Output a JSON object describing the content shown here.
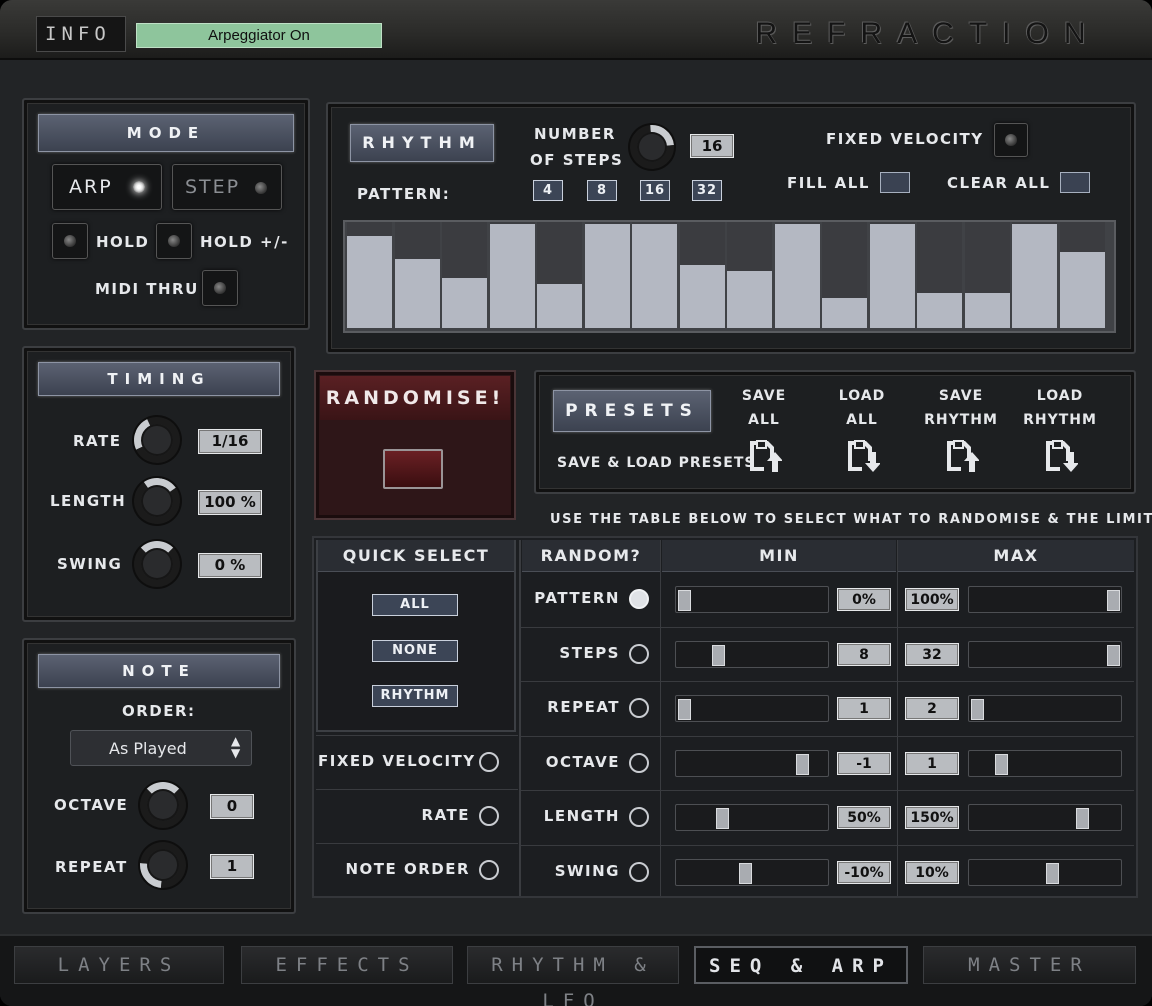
{
  "header": {
    "info_tag": "INFO",
    "info_display": "Arpeggiator On",
    "logo": "REFRACTION"
  },
  "mode": {
    "title": "MODE",
    "arp": "ARP",
    "step": "STEP",
    "hold": "HOLD",
    "hold_pm": "HOLD +/-",
    "midi_thru": "MIDI THRU",
    "arp_on": true
  },
  "timing": {
    "title": "TIMING",
    "rate_label": "RATE",
    "rate_value": "1/16",
    "length_label": "LENGTH",
    "length_value": "100 %",
    "swing_label": "SWING",
    "swing_value": "0 %"
  },
  "note": {
    "title": "NOTE",
    "order_label": "ORDER:",
    "order_value": "As Played",
    "octave_label": "OCTAVE",
    "octave_value": "0",
    "repeat_label": "REPEAT",
    "repeat_value": "1"
  },
  "rhythm": {
    "title": "RHYTHM",
    "steps_label_1": "NUMBER",
    "steps_label_2": "OF STEPS",
    "steps_value": "16",
    "pattern_label": "PATTERN:",
    "pattern_options": [
      "4",
      "8",
      "16",
      "32"
    ],
    "fixed_velocity": "FIXED VELOCITY",
    "fill_all": "FILL ALL",
    "clear_all": "CLEAR ALL",
    "steps": [
      0.88,
      0.66,
      0.48,
      1.0,
      0.42,
      1.0,
      1.0,
      0.61,
      0.55,
      1.0,
      0.29,
      1.0,
      0.34,
      0.34,
      1.0,
      0.73
    ]
  },
  "randomise": {
    "title": "RANDOMISE!"
  },
  "presets": {
    "title": "PRESETS",
    "subtitle": "SAVE & LOAD PRESETS",
    "actions": [
      {
        "line1": "SAVE",
        "line2": "ALL",
        "icon": "save-icon"
      },
      {
        "line1": "LOAD",
        "line2": "ALL",
        "icon": "load-icon"
      },
      {
        "line1": "SAVE",
        "line2": "RHYTHM",
        "icon": "save-icon"
      },
      {
        "line1": "LOAD",
        "line2": "RHYTHM",
        "icon": "load-icon"
      }
    ]
  },
  "random_table": {
    "instruction": "USE THE TABLE BELOW TO SELECT WHAT TO RANDOMISE & THE LIMITS",
    "quick_select": "QUICK SELECT",
    "all": "ALL",
    "none": "NONE",
    "rhythm": "RHYTHM",
    "extra_rows": [
      {
        "label": "FIXED VELOCITY",
        "on": false
      },
      {
        "label": "RATE",
        "on": false
      },
      {
        "label": "NOTE ORDER",
        "on": false
      }
    ],
    "col_random": "RANDOM?",
    "col_min": "MIN",
    "col_max": "MAX",
    "rows": [
      {
        "label": "PATTERN",
        "on": true,
        "min": "0%",
        "max": "100%",
        "min_pos": 0.0,
        "max_pos": 1.0
      },
      {
        "label": "STEPS",
        "on": false,
        "min": "8",
        "max": "32",
        "min_pos": 0.25,
        "max_pos": 1.0
      },
      {
        "label": "REPEAT",
        "on": false,
        "min": "1",
        "max": "2",
        "min_pos": 0.0,
        "max_pos": 0.0
      },
      {
        "label": "OCTAVE",
        "on": false,
        "min": "-1",
        "max": "1",
        "min_pos": 0.87,
        "max_pos": 0.18
      },
      {
        "label": "LENGTH",
        "on": false,
        "min": "50%",
        "max": "150%",
        "min_pos": 0.28,
        "max_pos": 0.77
      },
      {
        "label": "SWING",
        "on": false,
        "min": "-10%",
        "max": "10%",
        "min_pos": 0.45,
        "max_pos": 0.55
      }
    ]
  },
  "tabs": [
    {
      "label": "LAYERS",
      "selected": false
    },
    {
      "label": "EFFECTS",
      "selected": false
    },
    {
      "label": "RHYTHM & LFO",
      "selected": false
    },
    {
      "label": "SEQ & ARP",
      "selected": true
    },
    {
      "label": "MASTER",
      "selected": false
    }
  ]
}
